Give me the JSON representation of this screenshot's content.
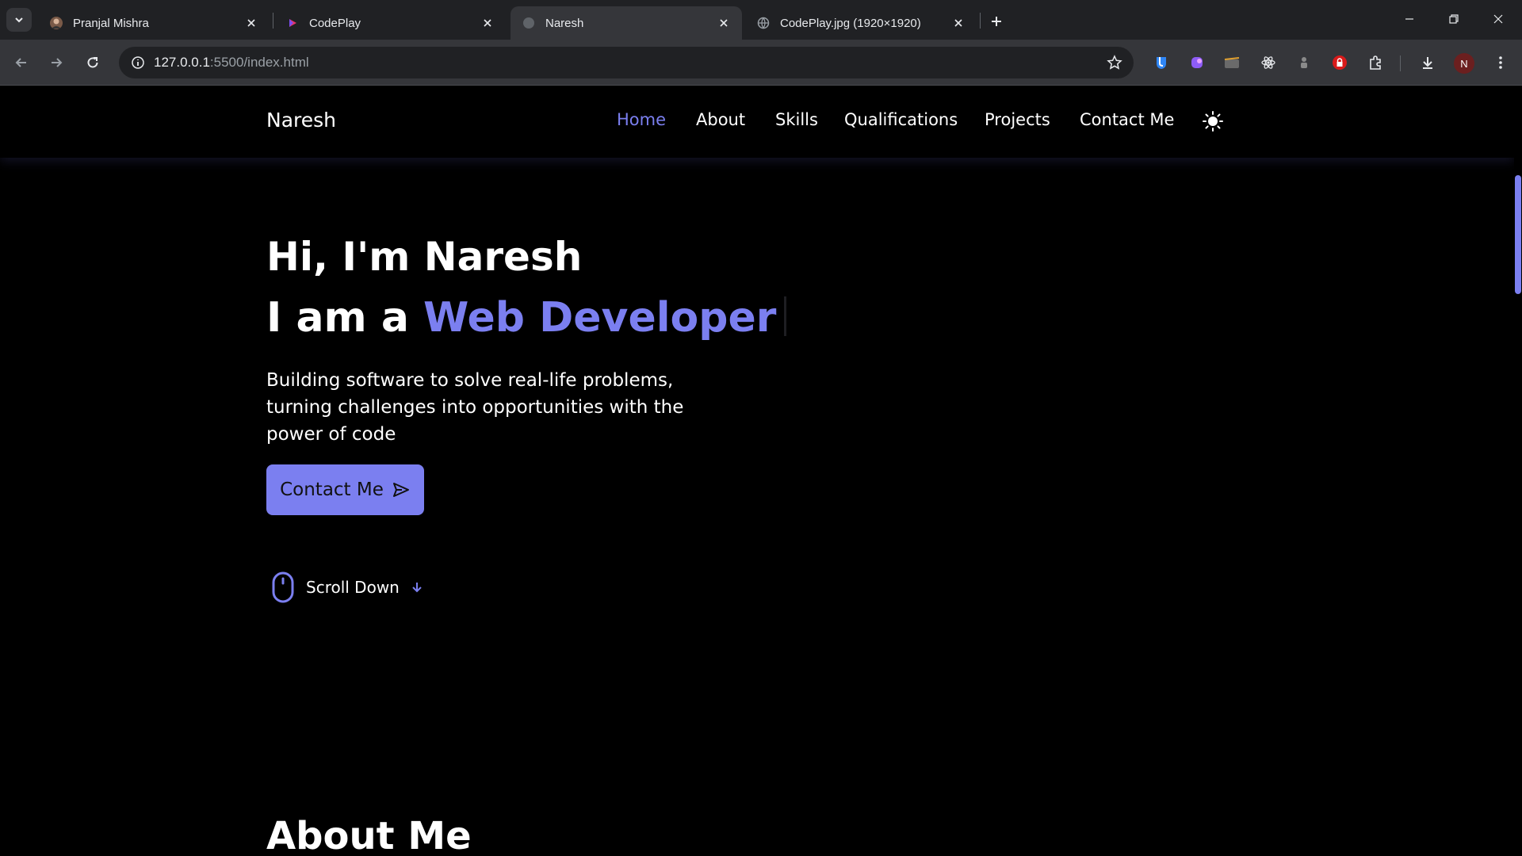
{
  "browser": {
    "tabs": [
      {
        "title": "Pranjal Mishra",
        "active": false
      },
      {
        "title": "CodePlay",
        "active": false
      },
      {
        "title": "Naresh",
        "active": true
      },
      {
        "title": "CodePlay.jpg (1920×1920)",
        "active": false
      }
    ],
    "url_host": "127.0.0.1",
    "url_path": ":5500/index.html",
    "profile_initial": "N",
    "icons": [
      "tab-search-icon",
      "back-icon",
      "forward-icon",
      "reload-icon",
      "site-info-icon",
      "star-icon",
      "extensions-icon",
      "download-icon",
      "menu-icon"
    ]
  },
  "site": {
    "logo": "Naresh",
    "nav": [
      "Home",
      "About",
      "Skills",
      "Qualifications",
      "Projects",
      "Contact Me"
    ],
    "active_nav": "Home",
    "hero": {
      "greeting": "Hi, I'm Naresh",
      "role_prefix": "I am a",
      "role": "Web Developer",
      "description": "Building software to solve real-life problems, turning challenges into opportunities with the power of code",
      "cta": "Contact Me",
      "scroll_label": "Scroll Down"
    },
    "about_title": "About Me"
  },
  "colors": {
    "accent": "#7b7ff0",
    "background": "#000000",
    "chrome": "#202124"
  }
}
